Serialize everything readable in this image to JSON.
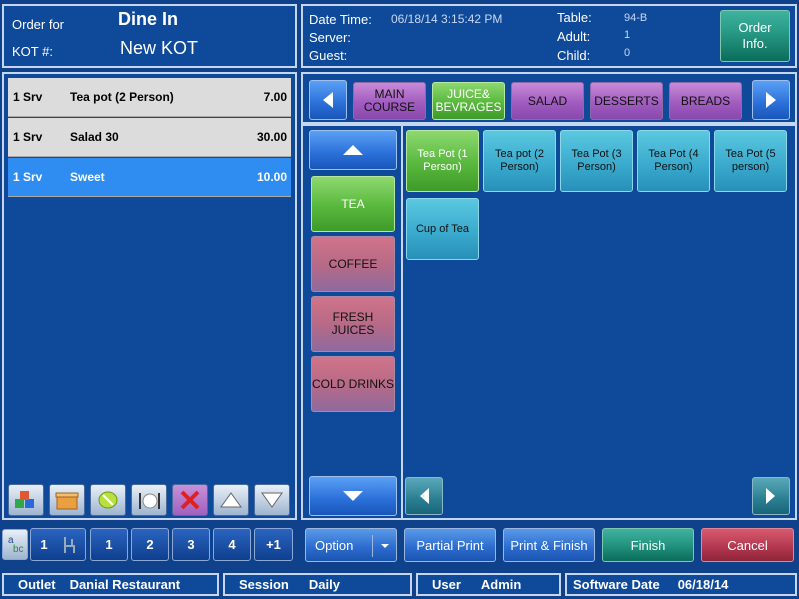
{
  "header": {
    "order_for_label": "Order for",
    "order_type": "Dine In",
    "kot_label": "KOT #:",
    "kot_value": "New KOT",
    "datetime_label": "Date Time:",
    "datetime_value": "06/18/14 3:15:42 PM",
    "server_label": "Server:",
    "guest_label": "Guest:",
    "table_label": "Table:",
    "table_value": "94-B",
    "adult_label": "Adult:",
    "adult_value": "1",
    "child_label": "Child:",
    "child_value": "0",
    "order_info_line1": "Order",
    "order_info_line2": "Info."
  },
  "order_items": [
    {
      "qty": "1 Srv",
      "name": "Tea pot (2 Person)",
      "price": "7.00",
      "selected": false
    },
    {
      "qty": "1 Srv",
      "name": "Salad 30",
      "price": "30.00",
      "selected": false
    },
    {
      "qty": "1 Srv",
      "name": "Sweet",
      "price": "10.00",
      "selected": true
    }
  ],
  "categories": [
    {
      "label": "MAIN COURSE",
      "active": false
    },
    {
      "label": "JUICE& BEVRAGES",
      "active": true
    },
    {
      "label": "SALAD",
      "active": false
    },
    {
      "label": "DESSERTS",
      "active": false
    },
    {
      "label": "BREADS",
      "active": false
    }
  ],
  "subcategories": [
    {
      "label": "TEA",
      "active": true
    },
    {
      "label": "COFFEE",
      "active": false
    },
    {
      "label": "FRESH JUICES",
      "active": false
    },
    {
      "label": "COLD DRINKS",
      "active": false
    }
  ],
  "products": [
    {
      "label": "Tea Pot (1 Person)",
      "active": true
    },
    {
      "label": "Tea pot (2 Person)",
      "active": false
    },
    {
      "label": "Tea Pot (3 Person)",
      "active": false
    },
    {
      "label": "Tea Pot (4 Person)",
      "active": false
    },
    {
      "label": "Tea Pot (5 person)",
      "active": false
    },
    {
      "label": "Cup of Tea",
      "active": false
    }
  ],
  "guests": {
    "seat_count": "1",
    "buttons": [
      "1",
      "2",
      "3",
      "4",
      "+1"
    ]
  },
  "actions": {
    "option": "Option",
    "partial_print": "Partial Print",
    "print_finish": "Print & Finish",
    "finish": "Finish",
    "cancel": "Cancel"
  },
  "status": {
    "outlet_label": "Outlet",
    "outlet_value": "Danial Restaurant",
    "session_label": "Session",
    "session_value": "Daily",
    "user_label": "User",
    "user_value": "Admin",
    "software_date_label": "Software Date",
    "software_date_value": "06/18/14"
  },
  "colors": {
    "background": "#10428c",
    "active_green": "#58b83c",
    "category_purple": "#a05cc0",
    "product_teal": "#38a8cc",
    "selected_row": "#2f8cf0"
  }
}
